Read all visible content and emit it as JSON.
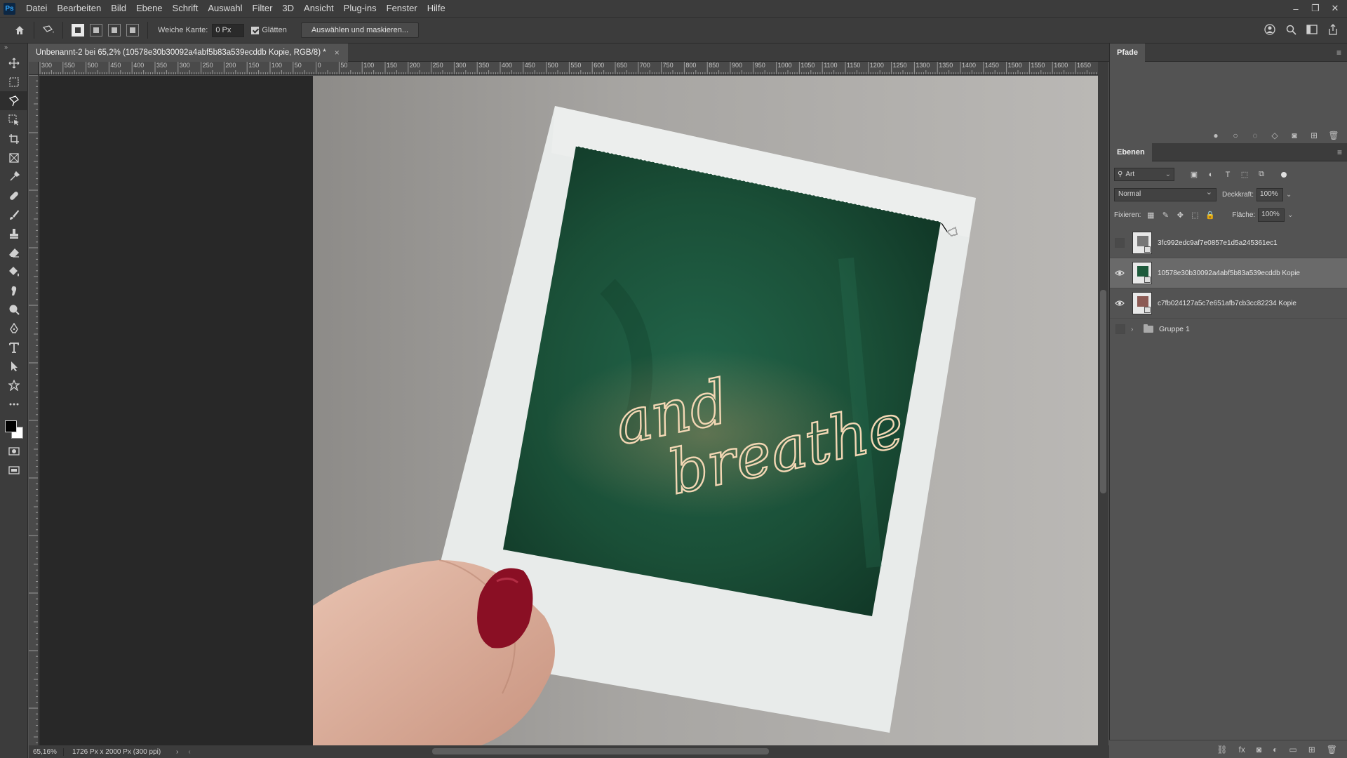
{
  "app": {
    "name": "Ps"
  },
  "menu": [
    "Datei",
    "Bearbeiten",
    "Bild",
    "Ebene",
    "Schrift",
    "Auswahl",
    "Filter",
    "3D",
    "Ansicht",
    "Plug-ins",
    "Fenster",
    "Hilfe"
  ],
  "window_controls": {
    "minimize": "–",
    "restore": "❐",
    "close": "✕"
  },
  "options": {
    "feather_label": "Weiche Kante:",
    "feather_value": "0 Px",
    "antialias_label": "Glätten",
    "select_mask_button": "Auswählen und maskieren..."
  },
  "document_tab": {
    "title": "Unbenannt-2 bei 65,2% (10578e30b30092a4abf5b83a539ecddb Kopie, RGB/8) *",
    "close": "×"
  },
  "ruler_h": [
    "300",
    "550",
    "500",
    "450",
    "400",
    "350",
    "300",
    "250",
    "200",
    "150",
    "100",
    "50",
    "0",
    "50",
    "100",
    "150",
    "200",
    "250",
    "300",
    "350",
    "400",
    "450",
    "500",
    "550",
    "600",
    "650",
    "700",
    "750",
    "800",
    "850",
    "900",
    "950",
    "1000",
    "1050",
    "1100",
    "1150",
    "1200",
    "1250",
    "1300",
    "1350",
    "1400",
    "1450",
    "1500",
    "1550",
    "1600",
    "1650"
  ],
  "status": {
    "zoom": "65,16%",
    "dimensions": "1726 Px x 2000 Px (300 ppi)"
  },
  "panels": {
    "paths": {
      "tab": "Pfade"
    },
    "layers": {
      "tab": "Ebenen",
      "filter_kind": "Art",
      "blend_mode": "Normal",
      "opacity_label": "Deckkraft:",
      "opacity_value": "100%",
      "lock_label": "Fixieren:",
      "fill_label": "Fläche:",
      "fill_value": "100%",
      "layers": [
        {
          "name": "3fc992edc9af7e0857e1d5a245361ec1",
          "visible": false,
          "selected": false
        },
        {
          "name": "10578e30b30092a4abf5b83a539ecddb  Kopie",
          "visible": true,
          "selected": true
        },
        {
          "name": "c7fb024127a5c7e651afb7cb3cc82234  Kopie",
          "visible": true,
          "selected": false
        }
      ],
      "group": {
        "name": "Gruppe 1"
      }
    }
  },
  "artwork": {
    "text_line1": "and",
    "text_line2": "breathe"
  },
  "colors": {
    "ui_dark": "#3c3c3c",
    "ui_mid": "#535353",
    "canvas_bg": "#282828",
    "accent_blue": "#31a8ff",
    "polaroid_green": "#1b4d37",
    "nail_red": "#8a0f24"
  }
}
